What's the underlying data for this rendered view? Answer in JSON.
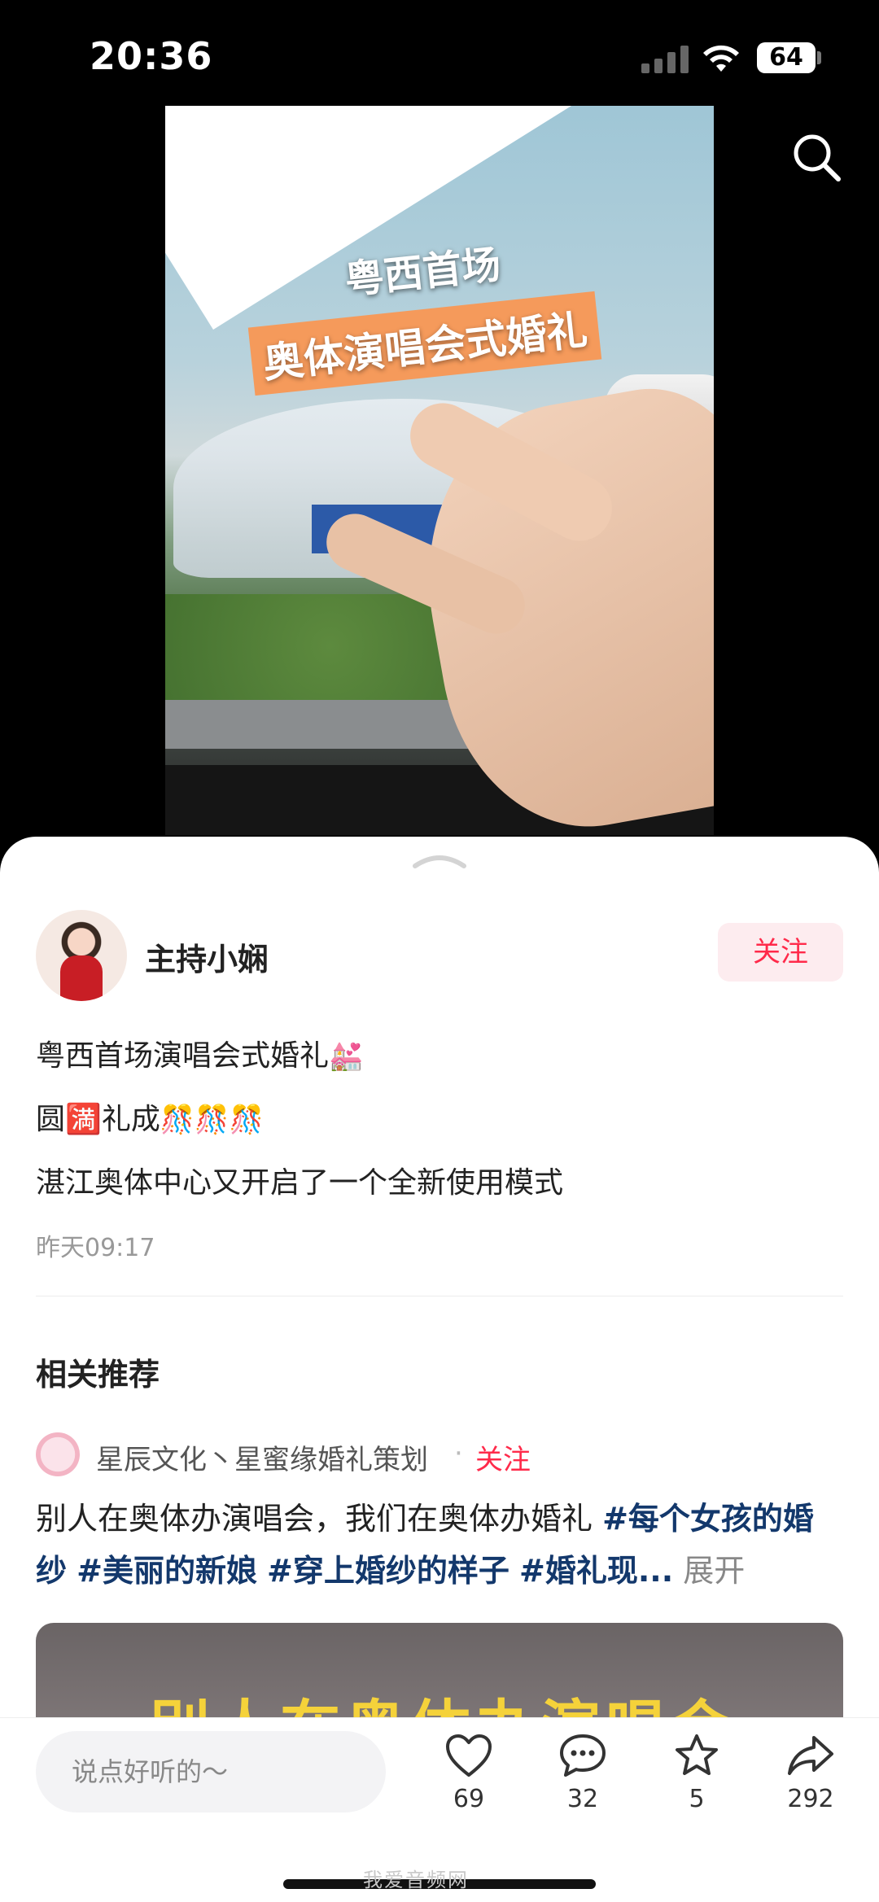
{
  "status_bar": {
    "time": "20:36",
    "battery": "64"
  },
  "video": {
    "overlay_line1": "粤西首场",
    "overlay_line2": "奥体演唱会式婚礼"
  },
  "author": {
    "name": "主持小娴",
    "follow_label": "关注"
  },
  "post": {
    "line1": "粤西首场演唱会式婚礼",
    "line1_emoji": "💒",
    "line2": "圆🈵礼成",
    "line2_emoji": "🎊🎊🎊",
    "line3": "湛江奥体中心又开启了一个全新使用模式",
    "time": "昨天09:17"
  },
  "related": {
    "title": "相关推荐",
    "author_name": "星辰文化丶星蜜缘婚礼策划",
    "separator": "·",
    "follow_label": "关注",
    "text_plain": "别人在奥体办演唱会，我们在奥体办婚礼 ",
    "tags": [
      "#每个女孩的婚纱",
      "#美丽的新娘",
      "#穿上婚纱的样子",
      "#婚礼现..."
    ],
    "expand_label": "展开",
    "thumb_text": "别人在奥体办演唱会"
  },
  "action_bar": {
    "placeholder": "说点好听的～",
    "likes": "69",
    "comments": "32",
    "favorites": "5",
    "shares": "292"
  },
  "watermark": "我爱音频网",
  "colors": {
    "accent": "#ff2a4a",
    "hashtag": "#13386c",
    "follow_bg": "#fdecef"
  }
}
